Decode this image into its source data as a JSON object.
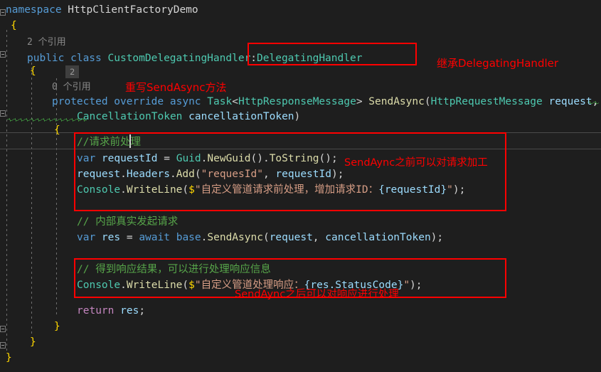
{
  "editor": {
    "theme_background": "#1e1e1e",
    "default_text_color": "#d4d4d4",
    "language": "csharp",
    "caret_line_text": "//请求前处理"
  },
  "codelens": {
    "class_references": "2 个引用",
    "method_references": "0 个引用",
    "inline_badge": "2"
  },
  "code": {
    "l01_namespace_kw": "namespace",
    "l01_namespace_name": " HttpClientFactoryDemo",
    "l02_brace": "{",
    "l04_public": "public",
    "l04_class": " class",
    "l04_name": " CustomDelegatingHandler",
    "l04_colon": ":",
    "l04_base": "DelegatingHandler",
    "l05_brace": "{",
    "l07_protected": "protected",
    "l07_override": " override",
    "l07_async": " async",
    "l07_task": " Task",
    "l07_lt": "<",
    "l07_resp": "HttpResponseMessage",
    "l07_gt": "> ",
    "l07_method": "SendAsync",
    "l07_paren": "(",
    "l07_reqtype": "HttpRequestMessage",
    "l07_reqparam": " request",
    "l07_comma": ",",
    "l08_cttype": "CancellationToken",
    "l08_ctparam": " cancellationToken",
    "l08_close": ")",
    "l09_brace": "{",
    "l10_comment": "//请求前处理",
    "l11_var": "var",
    "l11_requestid": " requestId",
    "l11_eq": " = ",
    "l11_guid": "Guid",
    "l11_dot1": ".",
    "l11_newguid": "NewGuid",
    "l11_p1": "().",
    "l11_tostring": "ToString",
    "l11_p2": "();",
    "l12_request": "request",
    "l12_dot1": ".",
    "l12_headers": "Headers",
    "l12_dot2": ".",
    "l12_add": "Add",
    "l12_open": "(",
    "l12_str": "\"requesId\"",
    "l12_comma": ", ",
    "l12_arg": "requestId",
    "l12_close": ");",
    "l13_console": "Console",
    "l13_dot": ".",
    "l13_writeline": "WriteLine",
    "l13_open": "(",
    "l13_dollar": "$",
    "l13_str1": "\"自定义管道请求前处理，增加请求ID：",
    "l13_interp": "{requestId}",
    "l13_str2": "\"",
    "l13_close": ");",
    "l15_comment": "// 内部真实发起请求",
    "l16_var": "var",
    "l16_res": " res",
    "l16_eq": " = ",
    "l16_await": "await",
    "l16_base": " base",
    "l16_dot": ".",
    "l16_sendasync": "SendAsync",
    "l16_open": "(",
    "l16_arg1": "request",
    "l16_comma": ", ",
    "l16_arg2": "cancellationToken",
    "l16_close": ");",
    "l18_comment": "// 得到响应结果，可以进行处理响应信息",
    "l19_console": "Console",
    "l19_dot": ".",
    "l19_writeline": "WriteLine",
    "l19_open": "(",
    "l19_dollar": "$",
    "l19_str1": "\"自定义管道处理响应：",
    "l19_interp": "{res.StatusCode}",
    "l19_str2": "\"",
    "l19_close": ");",
    "l21_return": "return",
    "l21_res": " res",
    "l21_semi": ";",
    "l22_brace": "}",
    "l23_brace": "}",
    "l24_brace": "}"
  },
  "annotations": {
    "inherit_note": "继承DelegatingHandler",
    "override_note": "重写SendAsync方法",
    "before_send_note": "SendAync之前可以对请求加工",
    "after_send_note": "SendAync之后可以对响应进行处理",
    "color": "#ff0000"
  }
}
